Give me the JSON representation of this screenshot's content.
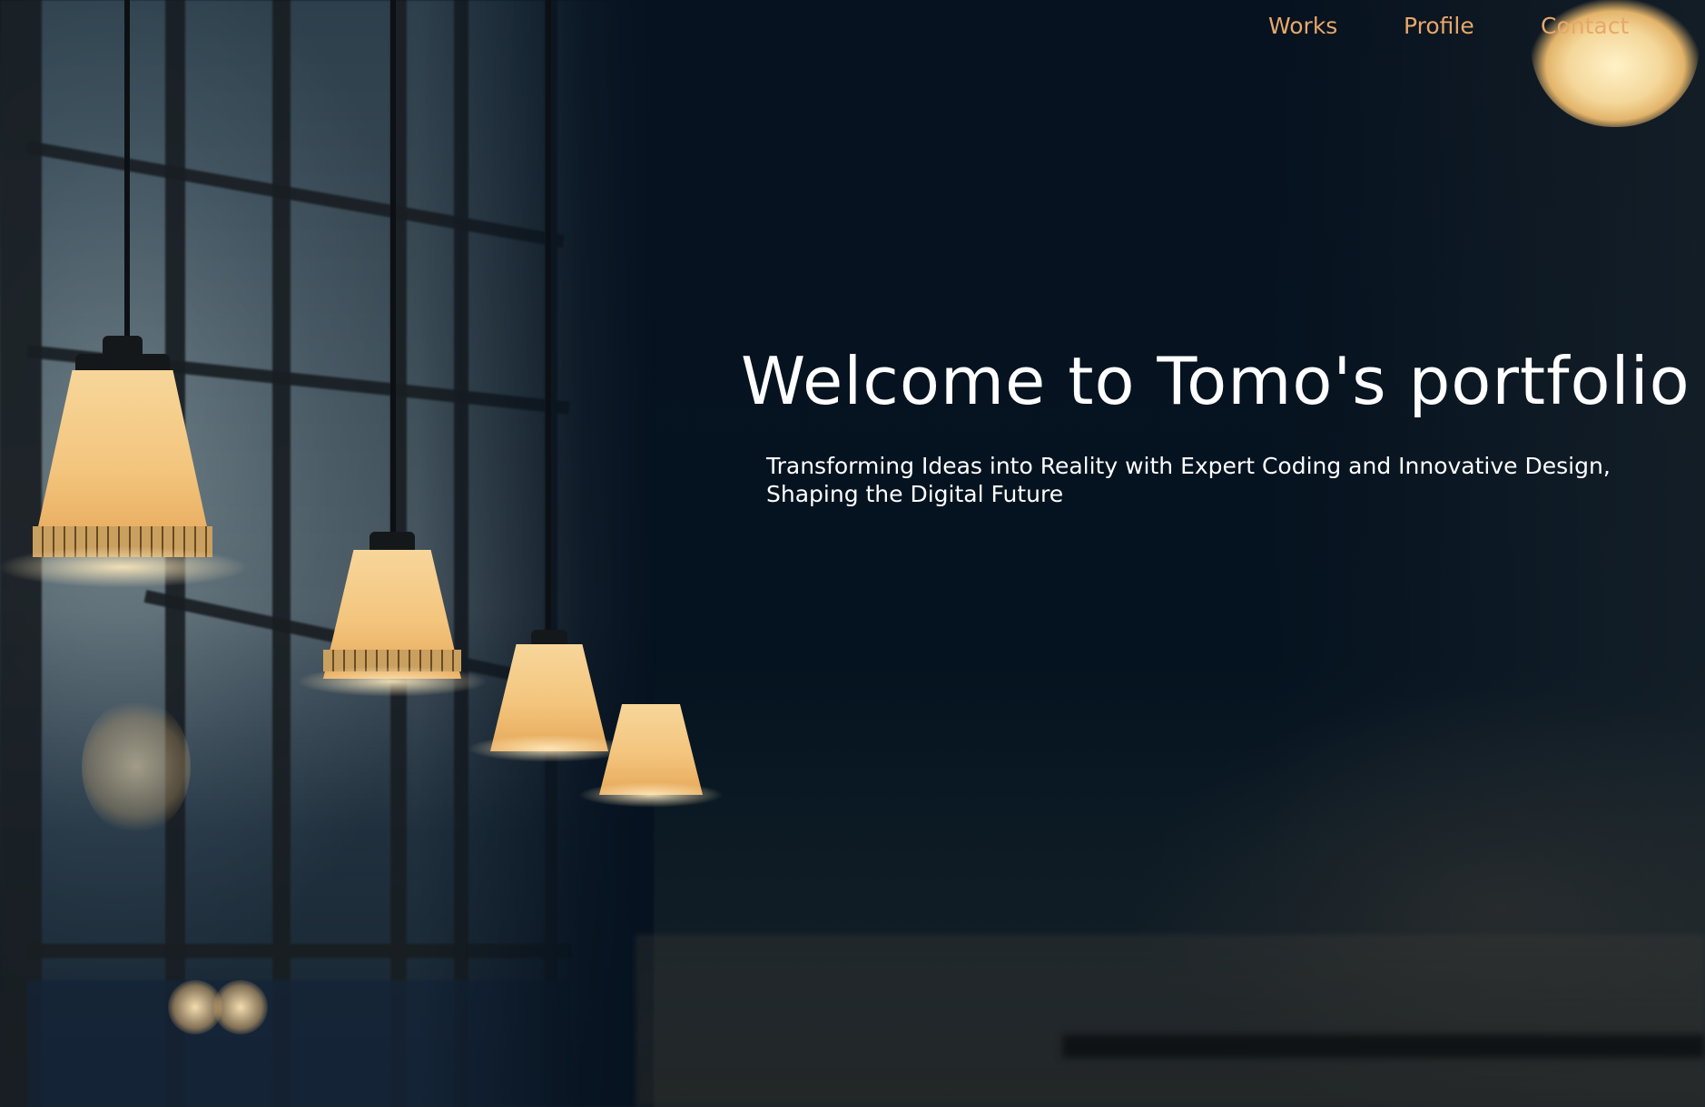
{
  "nav": {
    "items": [
      {
        "label": "Works"
      },
      {
        "label": "Profile"
      },
      {
        "label": "Contact"
      }
    ],
    "color": "#e8a76a"
  },
  "hero": {
    "title": "Welcome to Tomo's portfolio",
    "subtitle": "Transforming Ideas into Reality with Expert Coding and Innovative Design, Shaping the Digital Future",
    "background_icon": "pendant-lamps-photo"
  },
  "colors": {
    "background": "#071420",
    "heading": "#ffffff",
    "accent": "#e8a76a"
  }
}
